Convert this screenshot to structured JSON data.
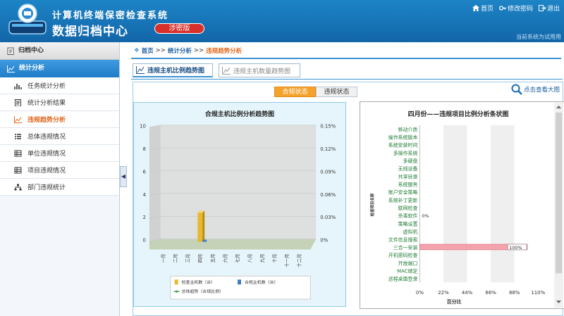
{
  "header": {
    "system_title": "计算机终端保密检查系统",
    "center_title": "数据归档中心",
    "badge": "涉密版",
    "links": [
      "首页",
      "修改密码",
      "退出"
    ],
    "current_user": "当前系统为试用用"
  },
  "sidebar": {
    "section1": "归档中心",
    "section2": "统计分析",
    "items": [
      {
        "label": "任务统计分析",
        "icon": "bar-chart-icon",
        "active": false
      },
      {
        "label": "统计分析结果",
        "icon": "document-icon",
        "active": false
      },
      {
        "label": "违规趋势分析",
        "icon": "line-chart-icon",
        "active": true
      },
      {
        "label": "总体违规情况",
        "icon": "list-icon",
        "active": false
      },
      {
        "label": "单位违规情况",
        "icon": "table-icon",
        "active": false
      },
      {
        "label": "项目违规情况",
        "icon": "table-icon",
        "active": false
      },
      {
        "label": "部门违规统计",
        "icon": "org-icon",
        "active": false
      }
    ]
  },
  "breadcrumb": {
    "home": "首页",
    "sep1": ">>",
    "section": "统计分析",
    "sep2": ">>",
    "current": "违规趋势分析"
  },
  "tabs": [
    "违规主机比例趋势图",
    "违规主机数量趋势图"
  ],
  "subtabs": [
    "合规状态",
    "违规状态"
  ],
  "zoom_label": "点击查看大图",
  "colors": {
    "accent": "#3c93d4",
    "active": "#e0671c",
    "badge": "#d9302a",
    "tab_on": "#f5a22c",
    "bar_check": "#e8b92e",
    "bar_compliant": "#3e7fc4",
    "hbar": "#f4a2ad"
  },
  "chart_data": [
    {
      "type": "bar",
      "title": "合规主机比例分析趋势图",
      "categories": [
        "一月",
        "二月",
        "三月",
        "四月",
        "五月",
        "六月",
        "七月",
        "八月",
        "九月",
        "十月",
        "十一月",
        "十二月"
      ],
      "y_ticks": [
        "0",
        "2",
        "4",
        "6",
        "8",
        "10"
      ],
      "y2_ticks": [
        "0%",
        "0.03%",
        "0.06%",
        "0.09%",
        "0.12%",
        "0.15%"
      ],
      "ylim": [
        0,
        10
      ],
      "series": [
        {
          "name": "检查主机数（台）",
          "values": [
            0,
            0,
            0,
            1,
            0,
            0,
            0,
            0,
            0,
            0,
            0,
            0
          ]
        },
        {
          "name": "合规主机数（台）",
          "values": [
            0,
            0,
            0,
            0,
            0,
            0,
            0,
            0,
            0,
            0,
            0,
            0
          ]
        },
        {
          "name": "总体趋势（合规比例）",
          "values": [
            0,
            0,
            0,
            0,
            0,
            0,
            0,
            0,
            0,
            0,
            0,
            0
          ]
        }
      ]
    },
    {
      "type": "bar",
      "title": "四月份——违规项目比例分析条状图",
      "ylabel": "检查项目名称",
      "xlabel": "百分比",
      "categories": [
        "移动介质",
        "操作系统版本",
        "系统安装时间",
        "多操作系统",
        "多硬盘",
        "无线设备",
        "共享目录",
        "系统服务",
        "账户安全策略",
        "系统补丁更新",
        "联网检查",
        "杀毒软件",
        "策略设置",
        "虚拟机",
        "文件信息搜索",
        "三合一安装",
        "开机密码检查",
        "开放端口",
        "MAC绑定",
        "远程桌面登录"
      ],
      "values": [
        0,
        0,
        0,
        0,
        0,
        0,
        0,
        0,
        0,
        0,
        0,
        0,
        0,
        0,
        0,
        100,
        0,
        0,
        0,
        0
      ],
      "point_labels": {
        "11": "0%",
        "15": "100%"
      },
      "x_ticks": [
        "0%",
        "22%",
        "44%",
        "66%",
        "88%",
        "110%"
      ],
      "xlim": [
        0,
        110
      ]
    }
  ]
}
